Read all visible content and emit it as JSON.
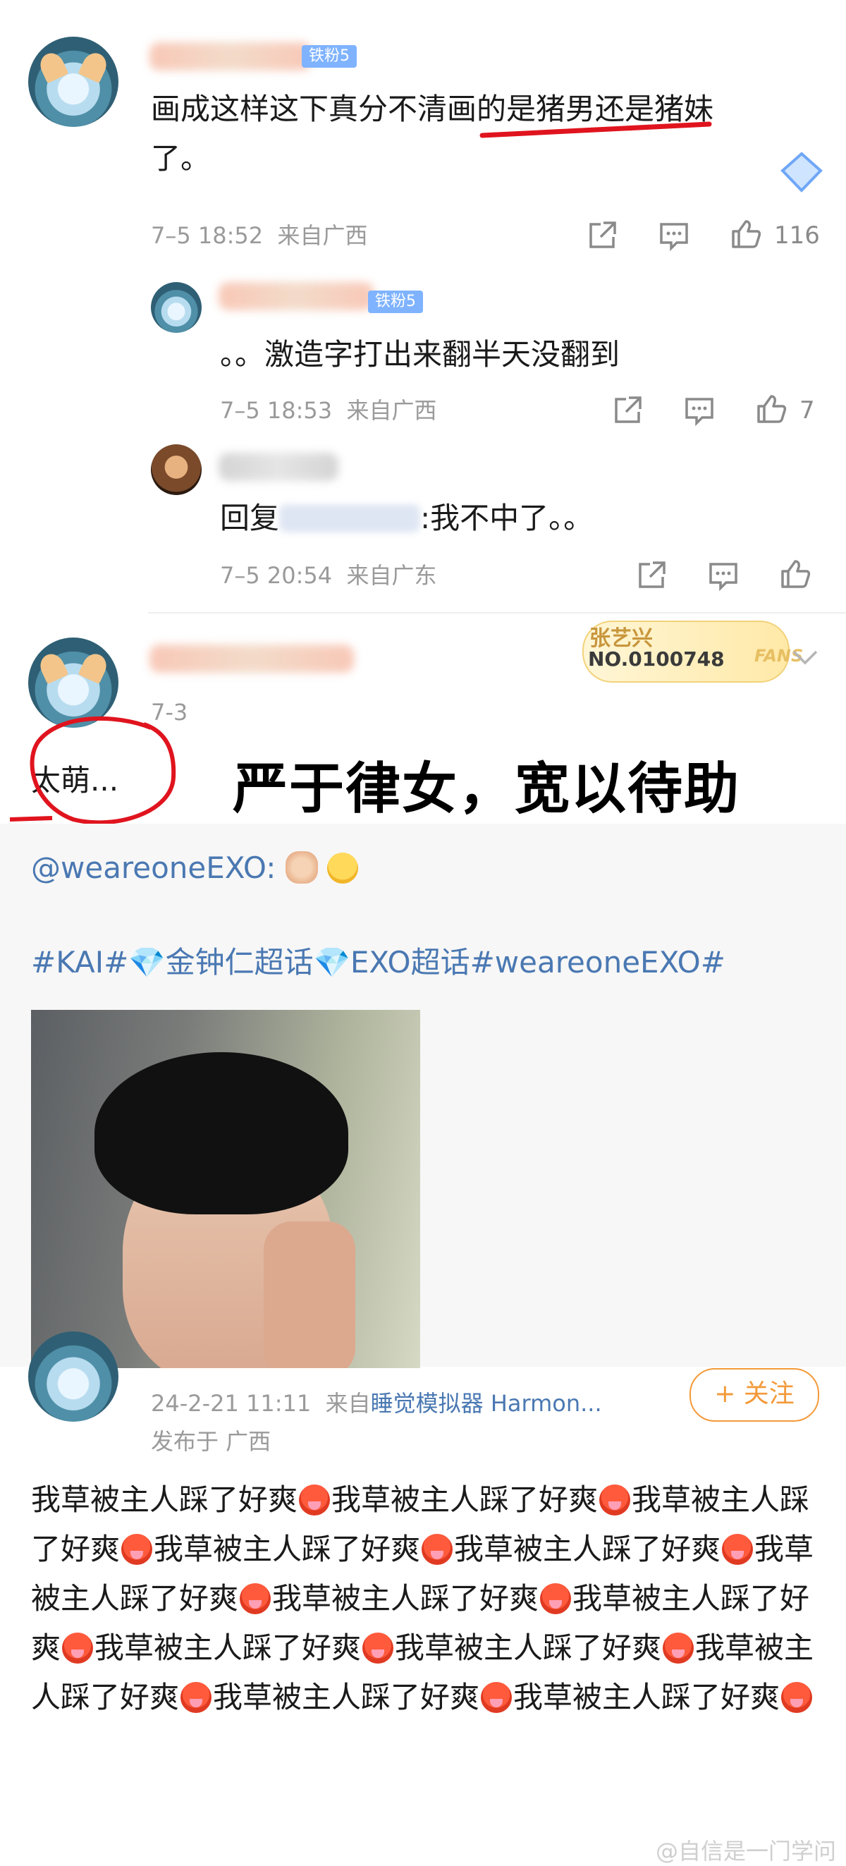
{
  "comment1": {
    "badge": "铁粉5",
    "text_line1": "画成这样这下真分不清画的是猪男还是猪妹",
    "text_line2": "了。",
    "time": "7–5 18:52",
    "location": "来自广西",
    "like_count": "116"
  },
  "reply1": {
    "badge": "铁粉5",
    "text": "。。激造字打出来翻半天没翻到",
    "time": "7–5 18:53",
    "location": "来自广西",
    "like_count": "7"
  },
  "reply2": {
    "text_prefix": "回复",
    "text_suffix": ":我不中了。。",
    "time": "7–5 20:54",
    "location": "来自广东"
  },
  "post1": {
    "date": "7-3",
    "text": "太萌...",
    "annotation": "严于律女，宽以待助",
    "fans_card": {
      "title": "张艺兴",
      "number": "NO.0100748",
      "label": "FANS"
    },
    "quoted_mention": "@weareoneEXO:",
    "hashtags": "#KAI#💎金钟仁超话💎EXO超话#weareoneEXO#"
  },
  "post2": {
    "time": "24-2-21 11:11",
    "source_prefix": "来自",
    "source": "睡觉模拟器 Harmon...",
    "published_in": "发布于 广西",
    "follow_label": "+ 关注",
    "body_phrase": "我草被主人踩了好爽"
  },
  "watermark": "@自信是一门学问",
  "colors": {
    "link": "#4a78b2",
    "badge": "#7fb3ff",
    "annotation_red": "#e0141e",
    "follow": "#f39a3a"
  }
}
